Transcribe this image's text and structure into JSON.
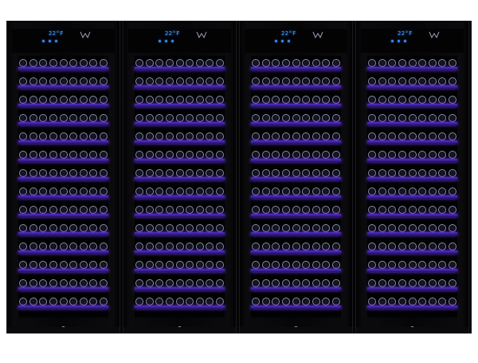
{
  "image": {
    "subject": "wine-cooler-bank",
    "unit_count": 4,
    "units": [
      {
        "temperature": "22°F",
        "shelves": 14
      },
      {
        "temperature": "22°F",
        "shelves": 14
      },
      {
        "temperature": "22°F",
        "shelves": 14
      },
      {
        "temperature": "22°F",
        "shelves": 14
      }
    ],
    "colors": {
      "body": "#050506",
      "shelf_light": "#5a2cc0",
      "display_blue": "#49a8ff",
      "background": "#ffffff"
    },
    "icons": [
      "logo-icon",
      "lock-icon"
    ]
  }
}
